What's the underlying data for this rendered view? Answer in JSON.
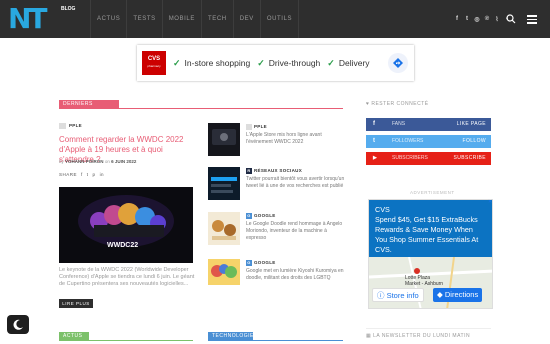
{
  "header": {
    "logo_text": "NT",
    "logo_sub": "BLOG",
    "nav": [
      "ACTUS",
      "TESTS",
      "MOBILE",
      "TECH",
      "DEV",
      "OUTILS"
    ],
    "social_icons": [
      "facebook-icon",
      "twitter-icon",
      "instagram-icon",
      "pinterest-icon",
      "rss-icon",
      "flipboard-icon"
    ],
    "social_glyphs": [
      "f",
      "t",
      "◎",
      "℗",
      "⌇",
      "▪"
    ]
  },
  "ad_banner": {
    "brand": "CVS",
    "brand_sub": "pharmacy",
    "options": [
      "In-store shopping",
      "Drive-through",
      "Delivery"
    ]
  },
  "sections": {
    "latest": "DERNIERS ARTICLES",
    "bottom_left": "ACTUS",
    "bottom_right": "TECHNOLOGIE"
  },
  "main_post": {
    "tag": "PPLE",
    "title": "Comment regarder la WWDC 2022 d'Apple à 19 heures et à quoi s'attendre ?",
    "author_prefix": "by",
    "author": "YOHANN POIRON",
    "date_prefix": "on",
    "date": "6 JUIN 2022",
    "share_label": "SHARE",
    "share_icons": [
      "f",
      "t",
      "p",
      "in"
    ],
    "hero_text": "WWDC22",
    "excerpt": "Le keynote de la WWDC 2022 (Worldwide Developer Conference) d'Apple se tiendra ce lundi 6 juin. Le géant de Cupertino présentera ses nouveautés logicielles...",
    "read_more": "LIRE PLUS"
  },
  "side_posts": [
    {
      "tag": "PPLE",
      "title": "L'Apple Store mis hors ligne avant l'événement WWDC 2022",
      "icon": "apple"
    },
    {
      "tag": "RÉSEAUX SOCIAUX",
      "title": "Twitter pourrait bientôt vous avertir lorsqu'un tweet lié à une de vos recherches est publié",
      "icon": "R"
    },
    {
      "tag": "GOOGLE",
      "title": "Le Google Doodle rend hommage à Angelo Moriondo, inventeur de la machine à expresso",
      "icon": "G"
    },
    {
      "tag": "GOOGLE",
      "title": "Google met en lumière Kiyoshi Kuromiya en doodle, militant des droits des LGBTQ",
      "icon": "G"
    }
  ],
  "sidebar": {
    "connected_title": "RESTER CONNECTÉ",
    "buttons": [
      {
        "icon": "f",
        "count": "FANS",
        "action": "LIKE PAGE",
        "color": "#3b5998"
      },
      {
        "icon": "t",
        "count": "FOLLOWERS",
        "action": "FOLLOW",
        "color": "#55acee"
      },
      {
        "icon": "▶",
        "count": "SUBSCRIBERS",
        "action": "SUBSCRIBE",
        "color": "#e62117"
      }
    ],
    "ad_label": "ADVERTISEMENT",
    "newsletter_title": "LA NEWSLETTER DU LUNDI MATIN"
  },
  "map_ad": {
    "brand": "CVS",
    "text": "Spend $45, Get $15 ExtraBucks Rewards & Save Money When You Shop Summer Essentials At CVS.",
    "place": "Lotte Plaza Market - Ashburn",
    "store_info": "Store info",
    "directions": "Directions"
  },
  "colors": {
    "accent": "#e85d75",
    "topbar": "#2e2e2e",
    "logo": "#29a8e0",
    "green": "#7cc16a",
    "blue": "#4a8fd4"
  }
}
